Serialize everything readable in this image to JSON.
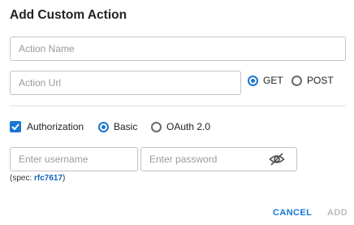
{
  "dialog": {
    "title": "Add Custom Action"
  },
  "action_name": {
    "placeholder": "Action Name",
    "value": ""
  },
  "action_url": {
    "placeholder": "Action Url",
    "value": ""
  },
  "method": {
    "options": [
      "GET",
      "POST"
    ],
    "selected": "GET"
  },
  "authorization": {
    "label": "Authorization",
    "checked": true,
    "types": [
      "Basic",
      "OAuth 2.0"
    ],
    "selected": "Basic"
  },
  "username": {
    "placeholder": "Enter username",
    "value": ""
  },
  "password": {
    "placeholder": "Enter password",
    "value": ""
  },
  "spec": {
    "prefix": "(spec: ",
    "link": "rfc7617",
    "suffix": ")"
  },
  "icons": {
    "password_toggle": "eye-off-icon",
    "checkbox": "checkmark-icon"
  },
  "colors": {
    "accent": "#1976d2",
    "link": "#1565c0",
    "disabled": "#bdbdbd"
  },
  "buttons": {
    "cancel": "CANCEL",
    "add": "ADD"
  }
}
